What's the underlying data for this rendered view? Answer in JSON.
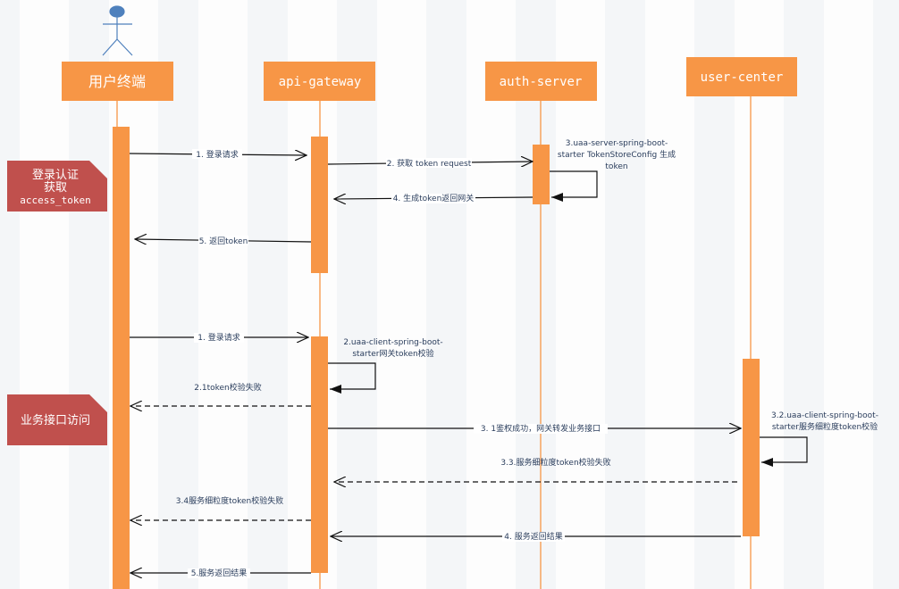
{
  "participants": [
    {
      "name": "用户终端",
      "type": "actor"
    },
    {
      "name": "api-gateway"
    },
    {
      "name": "auth-server"
    },
    {
      "name": "user-center"
    }
  ],
  "notes": [
    {
      "lines": [
        "登录认证",
        "获取",
        "access_token"
      ]
    },
    {
      "lines": [
        "业务接口访问"
      ]
    }
  ],
  "messages": [
    {
      "label": "1. 登录请求",
      "from": "用户终端",
      "to": "api-gateway",
      "style": "solid"
    },
    {
      "label": "2. 获取 token request",
      "from": "api-gateway",
      "to": "auth-server",
      "style": "solid"
    },
    {
      "label_lines": [
        "3.uaa-server-spring-boot-",
        "starter TokenStoreConfig 生成",
        "token"
      ],
      "from": "auth-server",
      "to": "auth-server",
      "style": "self"
    },
    {
      "label": "4. 生成token返回网关",
      "from": "auth-server",
      "to": "api-gateway",
      "style": "solid"
    },
    {
      "label": "5. 返回token",
      "from": "api-gateway",
      "to": "用户终端",
      "style": "solid"
    },
    {
      "label": "1. 登录请求",
      "from": "用户终端",
      "to": "api-gateway",
      "style": "solid"
    },
    {
      "label_lines": [
        "2.uaa-client-spring-boot-",
        "starter网关token校验"
      ],
      "from": "api-gateway",
      "to": "api-gateway",
      "style": "self"
    },
    {
      "label": "2.1token校验失败",
      "from": "api-gateway",
      "to": "用户终端",
      "style": "dashed"
    },
    {
      "label": "3. 1鉴权成功，网关转发业务接口",
      "from": "api-gateway",
      "to": "user-center",
      "style": "solid"
    },
    {
      "label_lines": [
        "3.2.uaa-client-spring-boot-",
        "starter服务细粒度token校验"
      ],
      "from": "user-center",
      "to": "user-center",
      "style": "self"
    },
    {
      "label": "3.3.服务细粒度token校验失败",
      "from": "user-center",
      "to": "api-gateway",
      "style": "dashed"
    },
    {
      "label": "3.4服务细粒度token校验失败",
      "from": "api-gateway",
      "to": "用户终端",
      "style": "dashed"
    },
    {
      "label": "4. 服务返回结果",
      "from": "user-center",
      "to": "api-gateway",
      "style": "solid"
    },
    {
      "label": "5.服务返回结果",
      "from": "api-gateway",
      "to": "用户终端",
      "style": "solid"
    }
  ],
  "colors": {
    "participant": "#f79646",
    "note": "#c0504d",
    "actor": "#4f81bd"
  }
}
